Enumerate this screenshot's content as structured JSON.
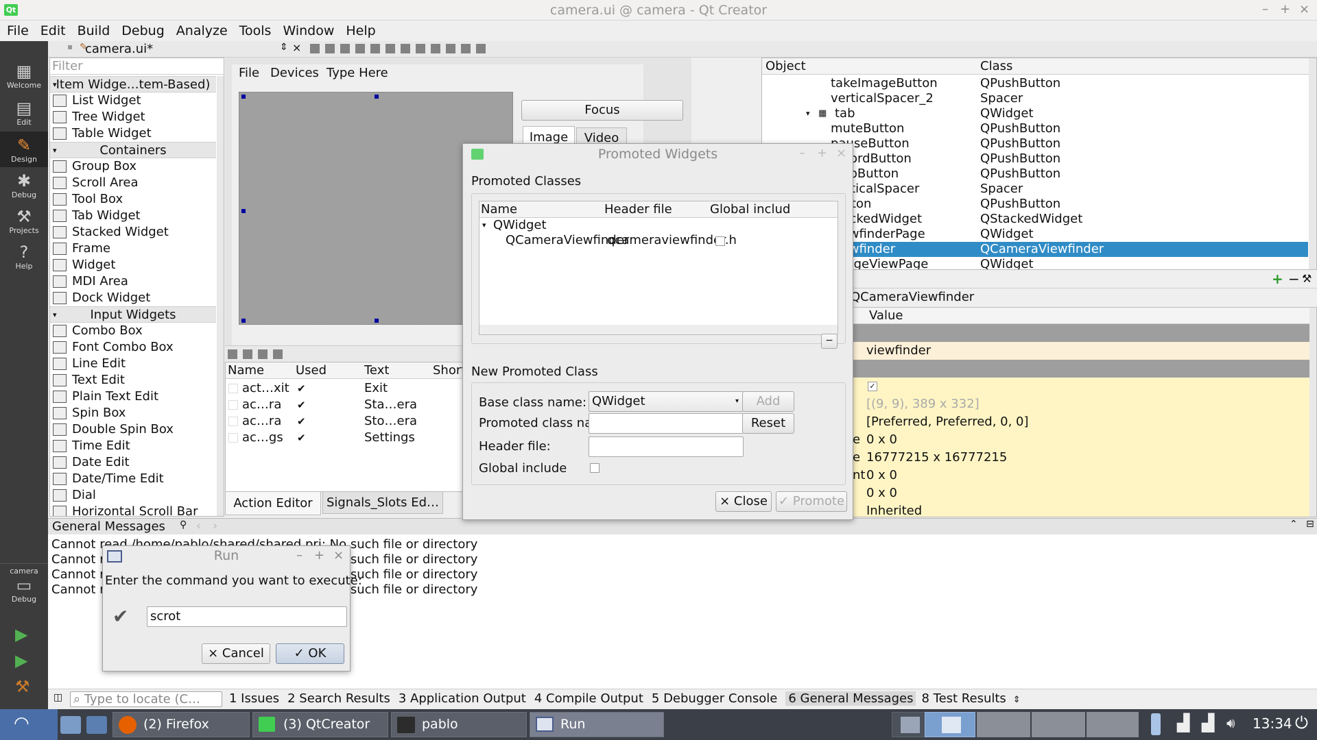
{
  "window": {
    "title": "camera.ui @ camera - Qt Creator",
    "logo": "Qt"
  },
  "menu": [
    "File",
    "Edit",
    "Build",
    "Debug",
    "Analyze",
    "Tools",
    "Window",
    "Help"
  ],
  "modes": [
    {
      "label": "Welcome",
      "icon": "grid-icon"
    },
    {
      "label": "Edit",
      "icon": "document-icon"
    },
    {
      "label": "Design",
      "icon": "pencil-icon"
    },
    {
      "label": "Debug",
      "icon": "bug-icon"
    },
    {
      "label": "Projects",
      "icon": "wrench-icon"
    },
    {
      "label": "Help",
      "icon": "help-icon"
    }
  ],
  "kit": {
    "project": "camera",
    "mode": "Debug"
  },
  "editor": {
    "file": "camera.ui*"
  },
  "widgetbox": {
    "filter_placeholder": "Filter",
    "categories": [
      {
        "title": "Item Widge…tem-Based)",
        "items": [
          "List Widget",
          "Tree Widget",
          "Table Widget"
        ]
      },
      {
        "title": "Containers",
        "items": [
          "Group Box",
          "Scroll Area",
          "Tool Box",
          "Tab Widget",
          "Stacked Widget",
          "Frame",
          "Widget",
          "MDI Area",
          "Dock Widget"
        ]
      },
      {
        "title": "Input Widgets",
        "items": [
          "Combo Box",
          "Font Combo Box",
          "Line Edit",
          "Text Edit",
          "Plain Text Edit",
          "Spin Box",
          "Double Spin Box",
          "Time Edit",
          "Date Edit",
          "Date/Time Edit",
          "Dial",
          "Horizontal Scroll Bar"
        ]
      }
    ]
  },
  "form": {
    "menu": [
      "File",
      "Devices",
      "Type Here"
    ],
    "focus_button": "Focus",
    "tabs": [
      "Image",
      "Video"
    ]
  },
  "actions": {
    "columns": [
      "Name",
      "Used",
      "Text",
      "Short"
    ],
    "rows": [
      {
        "name": "act…xit",
        "text": "Exit"
      },
      {
        "name": "ac…ra",
        "text": "Sta…era"
      },
      {
        "name": "ac…ra",
        "text": "Sto…era"
      },
      {
        "name": "ac…gs",
        "text": "Settings"
      }
    ],
    "tabs": [
      "Action Editor",
      "Signals_Slots Ed…"
    ]
  },
  "object_inspector": {
    "columns": [
      "Object",
      "Class"
    ],
    "rows": [
      {
        "object": "takeImageButton",
        "class": "QPushButton"
      },
      {
        "object": "verticalSpacer_2",
        "class": "Spacer"
      },
      {
        "object": "tab",
        "class": "QWidget"
      },
      {
        "object": "muteButton",
        "class": "QPushButton"
      },
      {
        "object": "pauseButton",
        "class": "QPushButton"
      },
      {
        "object": "recordButton",
        "class": "QPushButton"
      },
      {
        "object": "stopButton",
        "class": "QPushButton"
      },
      {
        "object": "verticalSpacer",
        "class": "Spacer"
      },
      {
        "object": "button",
        "class": "QPushButton"
      },
      {
        "object": "stackedWidget",
        "class": "QStackedWidget"
      },
      {
        "object": "viewfinderPage",
        "class": "QWidget"
      },
      {
        "object": "viewfinder",
        "class": "QCameraViewfinder"
      },
      {
        "object": "imageViewPage",
        "class": "QWidget"
      }
    ]
  },
  "property_editor": {
    "title": "QCameraViewfinder",
    "value_header": "Value",
    "rows": [
      {
        "label": "",
        "value": "viewfinder"
      },
      {
        "label": "",
        "value": ""
      },
      {
        "label": "",
        "value": "[(9, 9), 389 x 332]"
      },
      {
        "label": "",
        "value": "[Preferred, Preferred, 0, 0]"
      },
      {
        "label": "e",
        "value": "0 x 0"
      },
      {
        "label": "e",
        "value": "16777215 x 16777215"
      },
      {
        "label": "nt",
        "value": "0 x 0"
      },
      {
        "label": "",
        "value": "0 x 0"
      },
      {
        "label": "",
        "value": "Inherited"
      }
    ]
  },
  "promoted_dialog": {
    "title": "Promoted Widgets",
    "classes_label": "Promoted Classes",
    "columns": [
      "Name",
      "Header file",
      "Global includ"
    ],
    "parent": "QWidget",
    "child": {
      "name": "QCameraViewfinder",
      "header": "qcameraviewfinder.h"
    },
    "new_label": "New Promoted Class",
    "base_label": "Base class name:",
    "base_value": "QWidget",
    "promoted_label": "Promoted class name:",
    "header_label": "Header file:",
    "global_label": "Global include",
    "add": "Add",
    "reset": "Reset",
    "close": "Close",
    "promote": "Promote"
  },
  "messages": {
    "title": "General Messages",
    "lines": [
      "Cannot read /home/pablo/shared/shared.pri: No such file or directory",
      "Cannot read /home/pablo/shared/shared.pri: No such file or directory",
      "Cannot read /home/pablo/shared/shared.pri: No such file or directory",
      "Cannot read /home/pablo/shared/shared.pri: No such file or directory"
    ]
  },
  "run_dialog": {
    "title": "Run",
    "prompt": "Enter the command you want to execute:",
    "command": "scrot",
    "cancel": "Cancel",
    "ok": "OK"
  },
  "status": {
    "locate_placeholder": "Type to locate (C…",
    "tabs": [
      "1 Issues",
      "2 Search Results",
      "3 Application Output",
      "4 Compile Output",
      "5 Debugger Console",
      "6 General Messages",
      "8 Test Results"
    ]
  },
  "taskbar": {
    "tasks": [
      "(2) Firefox",
      "(3) QtCreator",
      "pablo",
      "Run"
    ],
    "clock": "13:34"
  }
}
